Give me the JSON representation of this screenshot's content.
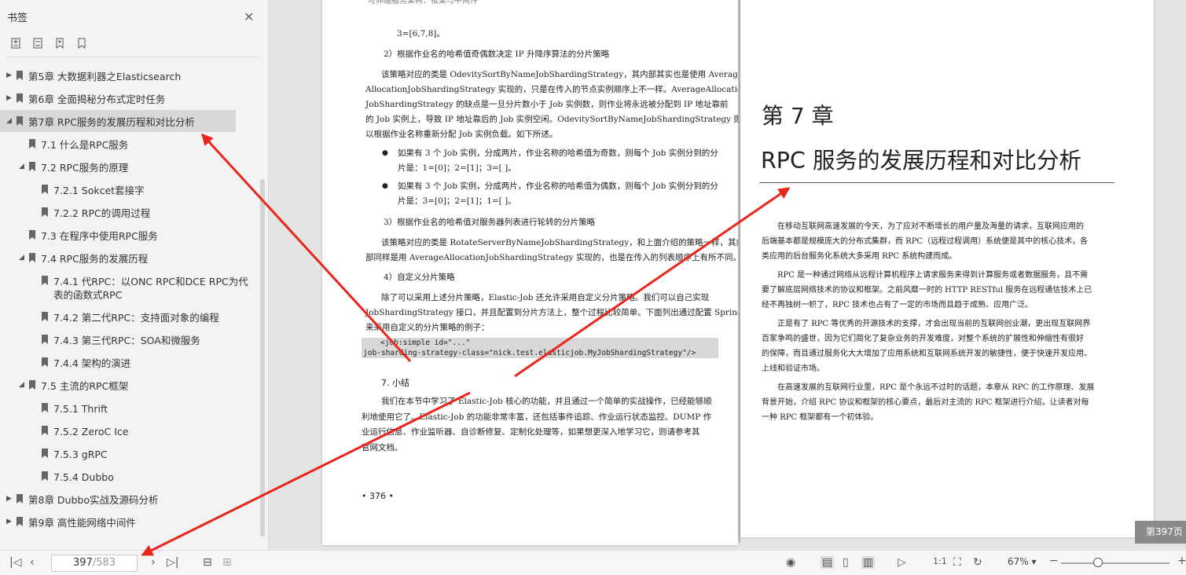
{
  "sidebar": {
    "title": "书签",
    "close_icon": "close-icon",
    "tools": [
      "expand-bookmarks-icon",
      "collapse-bookmarks-icon",
      "add-bookmark-icon",
      "bookmark-icon"
    ],
    "items": [
      {
        "label": "第5章 大数据利器之Elasticsearch",
        "level": 0,
        "expander": "collapsed"
      },
      {
        "label": "第6章 全面揭秘分布式定时任务",
        "level": 0,
        "expander": "collapsed"
      },
      {
        "label": "第7章 RPC服务的发展历程和对比分析",
        "level": 0,
        "expander": "expanded",
        "selected": true
      },
      {
        "label": "7.1 什么是RPC服务",
        "level": 1,
        "expander": "none"
      },
      {
        "label": "7.2 RPC服务的原理",
        "level": 1,
        "expander": "expanded"
      },
      {
        "label": "7.2.1 Sokcet套接字",
        "level": 2,
        "expander": "none"
      },
      {
        "label": "7.2.2 RPC的调用过程",
        "level": 2,
        "expander": "none"
      },
      {
        "label": "7.3 在程序中使用RPC服务",
        "level": 1,
        "expander": "none"
      },
      {
        "label": "7.4 RPC服务的发展历程",
        "level": 1,
        "expander": "expanded"
      },
      {
        "label": "7.4.1 代RPC：以ONC RPC和DCE RPC为代表的函数式RPC",
        "level": 2,
        "expander": "none"
      },
      {
        "label": "7.4.2 第二代RPC：支持面对象的编程",
        "level": 2,
        "expander": "none"
      },
      {
        "label": "7.4.3 第三代RPC：SOA和微服务",
        "level": 2,
        "expander": "none"
      },
      {
        "label": "7.4.4 架构的演进",
        "level": 2,
        "expander": "none"
      },
      {
        "label": "7.5 主流的RPC框架",
        "level": 1,
        "expander": "expanded"
      },
      {
        "label": "7.5.1 Thrift",
        "level": 2,
        "expander": "none"
      },
      {
        "label": "7.5.2 ZeroC Ice",
        "level": 2,
        "expander": "none"
      },
      {
        "label": "7.5.3 gRPC",
        "level": 2,
        "expander": "none"
      },
      {
        "label": "7.5.4 Dubbo",
        "level": 2,
        "expander": "none"
      },
      {
        "label": "第8章 Dubbo实战及源码分析",
        "level": 0,
        "expander": "collapsed"
      },
      {
        "label": "第9章 高性能网络中间件",
        "level": 0,
        "expander": "collapsed"
      }
    ]
  },
  "left_page": {
    "header": "可伸缩服务架构：框架与中间件",
    "lines": [
      "3=[6,7,8]。",
      "2）根据作业名的哈希值奇偶数决定 IP 升降序算法的分片策略",
      "该策略对应的类是 OdevitySortByNameJobShardingStrategy，其内部其实也是使用 Average",
      "AllocationJobShardingStrategy 实现的，只是在传入的节点实例顺序上不一样。AverageAllocation",
      "JobShardingStrategy 的缺点是一旦分片数小于 Job 实例数，则作业将永远被分配到 IP 地址靠前",
      "的 Job 实例上，导致 IP 地址靠后的 Job 实例空闲。OdevitySortByNameJobShardingStrategy 则可",
      "以根据作业名称重新分配 Job 实例负载。如下所述。",
      "如果有 3 个 Job 实例，分成两片，作业名称的哈希值为奇数，则每个 Job 实例分到的分",
      "片是：1=[0]；2=[1]；3=[ ]。",
      "如果有 3 个 Job 实例，分成两片，作业名称的哈希值为偶数，则每个 Job 实例分到的分",
      "片是：3=[0]；2=[1]；1=[ ]。",
      "3）根据作业名的哈希值对服务器列表进行轮转的分片策略",
      "该策略对应的类是 RotateServerByNameJobShardingStrategy，和上面介绍的策略一样，其内",
      "部同样是用 AverageAllocationJobShardingStrategy 实现的，也是在传入的列表顺序上有所不同。",
      "4）自定义分片策略",
      "除了可以采用上述分片策略，Elastic-Job 还允许采用自定义分片策略。我们可以自己实现",
      "JobShardingStrategy 接口，并且配置到分片方法上，整个过程比较简单。下面列出通过配置 Spring",
      "来采用自定义的分片策略的例子："
    ],
    "code": [
      "<job:simple id=\"...\"",
      "job-sharding-strategy-class=\"nick.test.elasticjob.MyJobShardingStrategy\"/>"
    ],
    "section": "7.  小结",
    "summary": [
      "我们在本节中学习了 Elastic-Job 核心的功能，并且通过一个简单的实战操作，已经能够顺",
      "利地使用它了。Elastic-Job 的功能非常丰富，还包括事件追踪、作业运行状态监控、DUMP 作",
      "业运行信息、作业监听器、自诊断修复、定制化处理等，如果想更深入地学习它，则请参考其",
      "官网文档。"
    ],
    "page_number": "• 376 •"
  },
  "right_page": {
    "chapter": "第 7 章",
    "title": "RPC 服务的发展历程和对比分析",
    "paragraphs": [
      "在移动互联网高速发展的今天，为了应对不断增长的用户量及海量的请求，互联网应用的",
      "后端基本都是规模庞大的分布式集群，而 RPC（远程过程调用）系统便是其中的核心技术，各",
      "类应用的后台服务化系统大多采用 RPC 系统构建而成。",
      "RPC 是一种通过网络从远程计算机程序上请求服务来得到计算服务或者数据服务，且不需",
      "要了解底层网络技术的协议和框架。之前风靡一时的 HTTP RESTful 服务在远程通信技术上已",
      "经不再独树一帜了，RPC 技术也占有了一定的市场而且趋于成熟、应用广泛。",
      "正是有了 RPC 等优秀的开源技术的支撑，才会出现当前的互联网创业潮，更出现互联网界",
      "百家争鸣的盛世，因为它们简化了复杂业务的开发难度，对整个系统的扩展性和伸缩性有很好",
      "的保障，而且通过服务化大大增加了应用系统和互联网系统开发的敏捷性，便于快速开发应用、",
      "上线和验证市场。",
      "在高速发展的互联网行业里，RPC 是个永远不过时的话题，本章从 RPC 的工作原理、发展",
      "背景开始，介绍 RPC 协议和框架的核心要点，最后对主流的 RPC 框架进行介绍，让读者对每",
      "一种 RPC 框架都有一个初体验。"
    ]
  },
  "page_badge": "第397页",
  "bottombar": {
    "current_page": "397",
    "total_pages": "/583",
    "zoom": "67%",
    "zoom_dropdown": "▾",
    "zoom_minus": "−",
    "zoom_plus": "+"
  },
  "colors": {
    "annotation_arrow": "#e8261b",
    "sidebar_bg": "#f3f3f3",
    "selected_bg": "#d8d8d8"
  }
}
